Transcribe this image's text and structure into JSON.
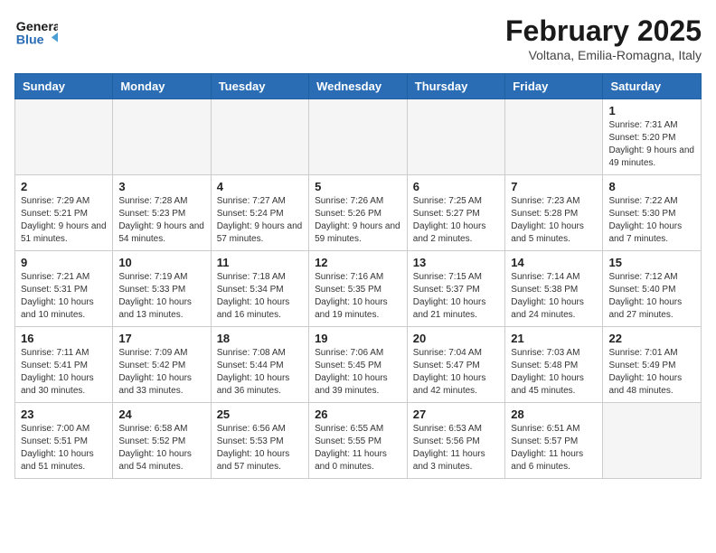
{
  "header": {
    "logo_general": "General",
    "logo_blue": "Blue",
    "main_title": "February 2025",
    "subtitle": "Voltana, Emilia-Romagna, Italy"
  },
  "weekdays": [
    "Sunday",
    "Monday",
    "Tuesday",
    "Wednesday",
    "Thursday",
    "Friday",
    "Saturday"
  ],
  "weeks": [
    [
      {
        "day": "",
        "info": ""
      },
      {
        "day": "",
        "info": ""
      },
      {
        "day": "",
        "info": ""
      },
      {
        "day": "",
        "info": ""
      },
      {
        "day": "",
        "info": ""
      },
      {
        "day": "",
        "info": ""
      },
      {
        "day": "1",
        "info": "Sunrise: 7:31 AM\nSunset: 5:20 PM\nDaylight: 9 hours and 49 minutes."
      }
    ],
    [
      {
        "day": "2",
        "info": "Sunrise: 7:29 AM\nSunset: 5:21 PM\nDaylight: 9 hours and 51 minutes."
      },
      {
        "day": "3",
        "info": "Sunrise: 7:28 AM\nSunset: 5:23 PM\nDaylight: 9 hours and 54 minutes."
      },
      {
        "day": "4",
        "info": "Sunrise: 7:27 AM\nSunset: 5:24 PM\nDaylight: 9 hours and 57 minutes."
      },
      {
        "day": "5",
        "info": "Sunrise: 7:26 AM\nSunset: 5:26 PM\nDaylight: 9 hours and 59 minutes."
      },
      {
        "day": "6",
        "info": "Sunrise: 7:25 AM\nSunset: 5:27 PM\nDaylight: 10 hours and 2 minutes."
      },
      {
        "day": "7",
        "info": "Sunrise: 7:23 AM\nSunset: 5:28 PM\nDaylight: 10 hours and 5 minutes."
      },
      {
        "day": "8",
        "info": "Sunrise: 7:22 AM\nSunset: 5:30 PM\nDaylight: 10 hours and 7 minutes."
      }
    ],
    [
      {
        "day": "9",
        "info": "Sunrise: 7:21 AM\nSunset: 5:31 PM\nDaylight: 10 hours and 10 minutes."
      },
      {
        "day": "10",
        "info": "Sunrise: 7:19 AM\nSunset: 5:33 PM\nDaylight: 10 hours and 13 minutes."
      },
      {
        "day": "11",
        "info": "Sunrise: 7:18 AM\nSunset: 5:34 PM\nDaylight: 10 hours and 16 minutes."
      },
      {
        "day": "12",
        "info": "Sunrise: 7:16 AM\nSunset: 5:35 PM\nDaylight: 10 hours and 19 minutes."
      },
      {
        "day": "13",
        "info": "Sunrise: 7:15 AM\nSunset: 5:37 PM\nDaylight: 10 hours and 21 minutes."
      },
      {
        "day": "14",
        "info": "Sunrise: 7:14 AM\nSunset: 5:38 PM\nDaylight: 10 hours and 24 minutes."
      },
      {
        "day": "15",
        "info": "Sunrise: 7:12 AM\nSunset: 5:40 PM\nDaylight: 10 hours and 27 minutes."
      }
    ],
    [
      {
        "day": "16",
        "info": "Sunrise: 7:11 AM\nSunset: 5:41 PM\nDaylight: 10 hours and 30 minutes."
      },
      {
        "day": "17",
        "info": "Sunrise: 7:09 AM\nSunset: 5:42 PM\nDaylight: 10 hours and 33 minutes."
      },
      {
        "day": "18",
        "info": "Sunrise: 7:08 AM\nSunset: 5:44 PM\nDaylight: 10 hours and 36 minutes."
      },
      {
        "day": "19",
        "info": "Sunrise: 7:06 AM\nSunset: 5:45 PM\nDaylight: 10 hours and 39 minutes."
      },
      {
        "day": "20",
        "info": "Sunrise: 7:04 AM\nSunset: 5:47 PM\nDaylight: 10 hours and 42 minutes."
      },
      {
        "day": "21",
        "info": "Sunrise: 7:03 AM\nSunset: 5:48 PM\nDaylight: 10 hours and 45 minutes."
      },
      {
        "day": "22",
        "info": "Sunrise: 7:01 AM\nSunset: 5:49 PM\nDaylight: 10 hours and 48 minutes."
      }
    ],
    [
      {
        "day": "23",
        "info": "Sunrise: 7:00 AM\nSunset: 5:51 PM\nDaylight: 10 hours and 51 minutes."
      },
      {
        "day": "24",
        "info": "Sunrise: 6:58 AM\nSunset: 5:52 PM\nDaylight: 10 hours and 54 minutes."
      },
      {
        "day": "25",
        "info": "Sunrise: 6:56 AM\nSunset: 5:53 PM\nDaylight: 10 hours and 57 minutes."
      },
      {
        "day": "26",
        "info": "Sunrise: 6:55 AM\nSunset: 5:55 PM\nDaylight: 11 hours and 0 minutes."
      },
      {
        "day": "27",
        "info": "Sunrise: 6:53 AM\nSunset: 5:56 PM\nDaylight: 11 hours and 3 minutes."
      },
      {
        "day": "28",
        "info": "Sunrise: 6:51 AM\nSunset: 5:57 PM\nDaylight: 11 hours and 6 minutes."
      },
      {
        "day": "",
        "info": ""
      }
    ]
  ]
}
